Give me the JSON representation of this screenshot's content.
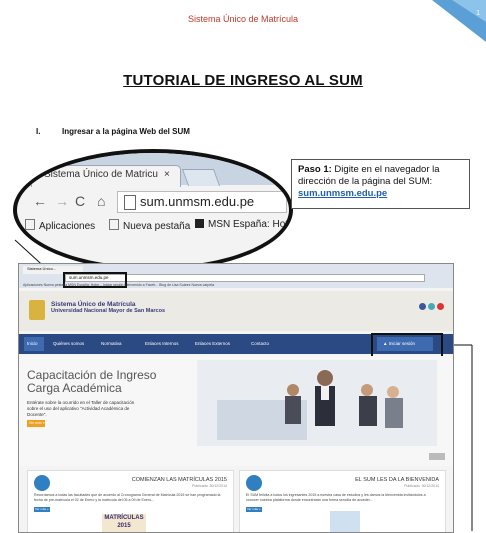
{
  "page": {
    "header_title": "Sistema Único de Matrícula",
    "page_number": "1",
    "doc_title": "TUTORIAL DE INGRESO AL SUM",
    "section_number": "I.",
    "section_title": "Ingresar a la página Web del SUM"
  },
  "zoom_browser": {
    "tab_title": "Sistema Único de Matricu",
    "tab_close": "×",
    "url": "sum.unmsm.edu.pe",
    "bookmarks": [
      "Aplicaciones",
      "Nueva pestaña",
      "MSN España: Hotm"
    ],
    "nav_icons": [
      "back-arrow-icon",
      "forward-arrow-icon",
      "reload-icon",
      "home-icon",
      "page-icon"
    ]
  },
  "callout": {
    "label": "Paso 1:",
    "text": " Digite en el navegador la dirección de la página del SUM: ",
    "link": "sum.unmsm.edu.pe"
  },
  "screenshot": {
    "tab_title": "Sistema Único...",
    "url": "sum.unmsm.edu.pe",
    "bookmarks_line": "Aplicaciones   Nueva pestaña   MSN España: Hotm...   Iniciar sesión   Bienvenido a Faceb...   Blog de Lisa Suárez   Nueva carpeta",
    "site_name": "Sistema Único de Matrícula",
    "university": "Universidad Nacional Mayor de San Marcos",
    "nav": {
      "home": "Inicio",
      "quienes": "Quiénes somos",
      "normativa": "Normativa",
      "enlaces_internos": "Enlaces Internos",
      "enlaces_externos": "Enlaces Externos",
      "contacto": "Contacto",
      "iniciar": "▲ Iniciar sesión"
    },
    "hero": {
      "title_line1": "Capacitación de Ingreso",
      "title_line2": "Carga Académica",
      "text": "Entérate sobre la ocurrido en el Taller de capacitación sobre el uso del aplicativo \"Actividad Académica de Docente\".",
      "button": "Ver más »"
    },
    "cards": [
      {
        "title": "COMIENZAN LAS MATRÍCULAS 2015",
        "date": "Publicado: 30/12/2014",
        "text": "Recordamos a todas las facultades que de acuerdo al Cronograma General de Matrícula 2015 se han programado la fecha de pre-matrícula el 02 de Enero y la matrícula del 05 a 09 de Enero...",
        "button": "Ver más »",
        "image_text": "MATRÍCULAS 2015"
      },
      {
        "title": "EL SUM LES DA LA BIENVENIDA",
        "date": "Publicado: 30/12/2014",
        "text": "El SUM felicita a todos los ingresantes 2015 a nuestra casa de estudios y les damos la bienvenida invitándolos a conocer nuestra plataforma donde encontrarán una forma sencilla de acceder...",
        "button": "Ver más »"
      }
    ]
  },
  "colors": {
    "header_red": "#c0392b",
    "site_nav_blue": "#2b4a84",
    "link_blue": "#1f5fae",
    "button_orange": "#f0a020"
  }
}
